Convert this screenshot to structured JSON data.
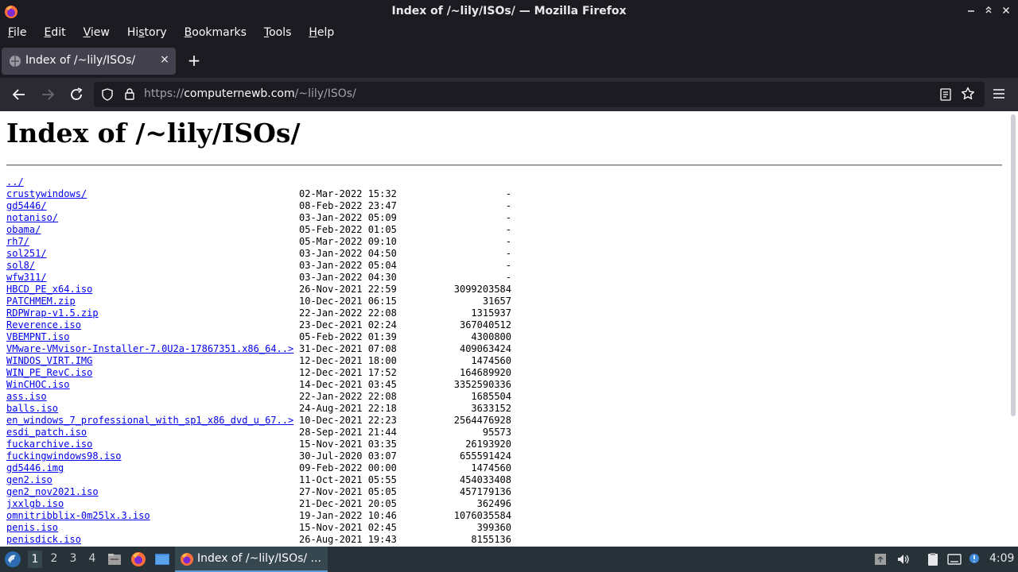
{
  "window": {
    "title": "Index of /~lily/ISOs/ — Mozilla Firefox",
    "minimize_icon": "minimize-icon",
    "maximize_icon": "maximize-icon",
    "close_icon": "close-icon"
  },
  "menubar": {
    "items": [
      {
        "label": "File",
        "accel": "F"
      },
      {
        "label": "Edit",
        "accel": "E"
      },
      {
        "label": "View",
        "accel": "V"
      },
      {
        "label": "History",
        "accel": "s"
      },
      {
        "label": "Bookmarks",
        "accel": "B"
      },
      {
        "label": "Tools",
        "accel": "T"
      },
      {
        "label": "Help",
        "accel": "H"
      }
    ]
  },
  "tabs": [
    {
      "title": "Index of /~lily/ISOs/",
      "close": "×"
    }
  ],
  "newtab_label": "+",
  "navbar": {
    "url_prefix": "https://",
    "url_host": "computernewb.com",
    "url_path": "/~lily/ISOs/"
  },
  "page": {
    "heading": "Index of /~lily/ISOs/",
    "parent": "../",
    "entries": [
      {
        "name": "crustywindows/",
        "date": "02-Mar-2022 15:32",
        "size": "-"
      },
      {
        "name": "gd5446/",
        "date": "08-Feb-2022 23:47",
        "size": "-"
      },
      {
        "name": "notaniso/",
        "date": "03-Jan-2022 05:09",
        "size": "-"
      },
      {
        "name": "obama/",
        "date": "05-Feb-2022 01:05",
        "size": "-"
      },
      {
        "name": "rh7/",
        "date": "05-Mar-2022 09:10",
        "size": "-"
      },
      {
        "name": "sol251/",
        "date": "03-Jan-2022 04:50",
        "size": "-"
      },
      {
        "name": "sol8/",
        "date": "03-Jan-2022 05:04",
        "size": "-"
      },
      {
        "name": "wfw311/",
        "date": "03-Jan-2022 04:30",
        "size": "-"
      },
      {
        "name": "HBCD_PE_x64.iso",
        "date": "26-Nov-2021 22:59",
        "size": "3099203584"
      },
      {
        "name": "PATCHMEM.zip",
        "date": "10-Dec-2021 06:15",
        "size": "31657"
      },
      {
        "name": "RDPWrap-v1.5.zip",
        "date": "22-Jan-2022 22:08",
        "size": "1315937"
      },
      {
        "name": "Reverence.iso",
        "date": "23-Dec-2021 02:24",
        "size": "367040512"
      },
      {
        "name": "VBEMPNT.iso",
        "date": "05-Feb-2022 01:39",
        "size": "4300800"
      },
      {
        "name": "VMware-VMvisor-Installer-7.0U2a-17867351.x86_64..>",
        "date": "31-Dec-2021 07:08",
        "size": "409063424"
      },
      {
        "name": "WINDOS_VIRT.IMG",
        "date": "12-Dec-2021 18:00",
        "size": "1474560"
      },
      {
        "name": "WIN_PE_RevC.iso",
        "date": "12-Dec-2021 17:52",
        "size": "164689920"
      },
      {
        "name": "WinCHOC.iso",
        "date": "14-Dec-2021 03:45",
        "size": "3352590336"
      },
      {
        "name": "ass.iso",
        "date": "22-Jan-2022 22:08",
        "size": "1685504"
      },
      {
        "name": "balls.iso",
        "date": "24-Aug-2021 22:18",
        "size": "3633152"
      },
      {
        "name": "en_windows_7_professional_with_sp1_x86_dvd_u_67..>",
        "date": "10-Dec-2021 22:23",
        "size": "2564476928"
      },
      {
        "name": "esdi_patch.iso",
        "date": "28-Sep-2021 21:44",
        "size": "95573"
      },
      {
        "name": "fuckarchive.iso",
        "date": "15-Nov-2021 03:35",
        "size": "26193920"
      },
      {
        "name": "fuckingwindows98.iso",
        "date": "30-Jul-2020 03:07",
        "size": "655591424"
      },
      {
        "name": "gd5446.img",
        "date": "09-Feb-2022 00:00",
        "size": "1474560"
      },
      {
        "name": "gen2.iso",
        "date": "11-Oct-2021 05:55",
        "size": "454033408"
      },
      {
        "name": "gen2_nov2021.iso",
        "date": "27-Nov-2021 05:05",
        "size": "457179136"
      },
      {
        "name": "jxxlgb.iso",
        "date": "21-Dec-2021 20:05",
        "size": "362496"
      },
      {
        "name": "omnitribblix-0m25lx.3.iso",
        "date": "19-Jan-2022 10:46",
        "size": "1076035584"
      },
      {
        "name": "penis.iso",
        "date": "15-Nov-2021 02:45",
        "size": "399360"
      },
      {
        "name": "penisdick.iso",
        "date": "26-Aug-2021 19:43",
        "size": "8155136"
      }
    ]
  },
  "taskbar": {
    "workspaces": [
      "1",
      "2",
      "3",
      "4"
    ],
    "active_workspace": "1",
    "task_label": "Index of /~lily/ISOs/ ...",
    "clock": "4:09"
  },
  "colors": {
    "chrome_dark": "#1c1b22",
    "toolbar": "#2b2a33",
    "tab_active": "#42414d",
    "link": "#0000ee",
    "taskbar": "#263238"
  }
}
